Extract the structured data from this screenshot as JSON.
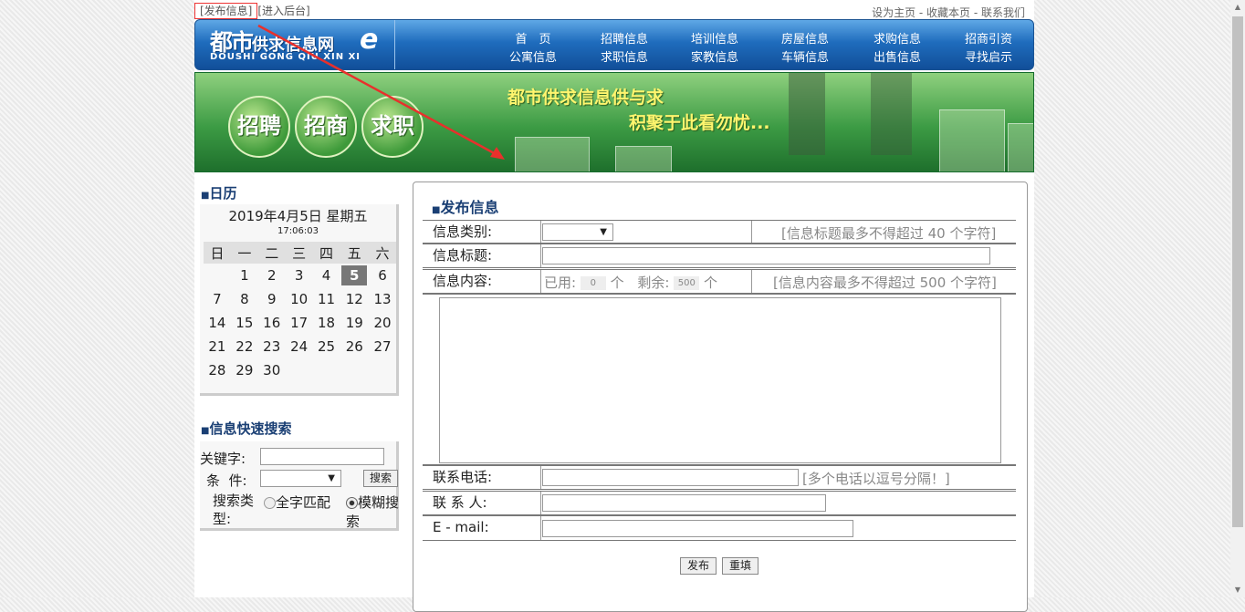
{
  "top": {
    "publish_link": "[发布信息]",
    "admin_link": "[进入后台]",
    "right_links": "设为主页 - 收藏本页 - 联系我们"
  },
  "logo": {
    "main": "都市",
    "sub": "供求信息网",
    "en": "DOUSHI  GONG QIU XIN XI",
    "e": "e"
  },
  "nav": [
    {
      "label": "首　页"
    },
    {
      "label": "招聘信息"
    },
    {
      "label": "培训信息"
    },
    {
      "label": "房屋信息"
    },
    {
      "label": "求购信息"
    },
    {
      "label": "招商引资"
    },
    {
      "label": "公寓信息"
    },
    {
      "label": "求职信息"
    },
    {
      "label": "家教信息"
    },
    {
      "label": "车辆信息"
    },
    {
      "label": "出售信息"
    },
    {
      "label": "寻找启示"
    }
  ],
  "banner": {
    "buttons": [
      "招聘",
      "招商",
      "求职"
    ],
    "slogan1": "都市供求信息供与求",
    "slogan2": "积聚于此看勿忧..."
  },
  "calendar": {
    "title": "日历",
    "date": "2019年4月5日 星期五",
    "time": "17:06:03",
    "weekdays": [
      "日",
      "一",
      "二",
      "三",
      "四",
      "五",
      "六"
    ],
    "weeks": [
      [
        "",
        "1",
        "2",
        "3",
        "4",
        "5",
        "6"
      ],
      [
        "7",
        "8",
        "9",
        "10",
        "11",
        "12",
        "13"
      ],
      [
        "14",
        "15",
        "16",
        "17",
        "18",
        "19",
        "20"
      ],
      [
        "21",
        "22",
        "23",
        "24",
        "25",
        "26",
        "27"
      ],
      [
        "28",
        "29",
        "30",
        "",
        "",
        "",
        ""
      ]
    ],
    "today": "5"
  },
  "quick_search": {
    "title": "信息快速搜索",
    "keyword_label": "关键字:",
    "keyword_value": "",
    "condition_label": "条  件:",
    "condition_value": "",
    "search_button": "搜索",
    "type_label": "搜索类型:",
    "option_exact": "全字匹配",
    "option_fuzzy": "模糊搜索",
    "selected": "模糊搜索"
  },
  "form": {
    "title": "发布信息",
    "category_label": "信息类别:",
    "category_value": "",
    "title_hint": "[信息标题最多不得超过 40 个字符]",
    "title_label": "信息标题:",
    "title_value": "",
    "content_label": "信息内容:",
    "used_label": "已用:",
    "used_count": "0",
    "unit": "个",
    "remain_label": "剩余:",
    "remain_count": "500",
    "content_hint": "[信息内容最多不得超过 500 个字符]",
    "content_value": "",
    "phone_label": "联系电话:",
    "phone_value": "",
    "phone_hint": "[多个电话以逗号分隔！]",
    "contact_label": "联 系 人:",
    "contact_value": "",
    "email_label": "E - mail:",
    "email_value": "",
    "submit_button": "发布",
    "reset_button": "重填"
  }
}
